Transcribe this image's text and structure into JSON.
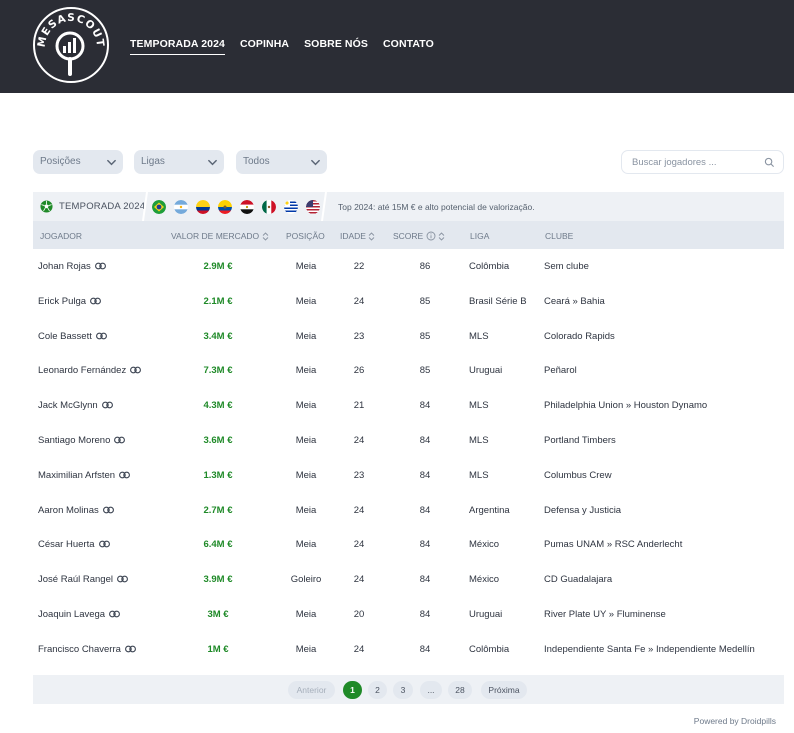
{
  "brand": {
    "logo_text": "MESASCOUT"
  },
  "nav": {
    "items": [
      {
        "label": "TEMPORADA 2024",
        "active": true
      },
      {
        "label": "COPINHA",
        "active": false
      },
      {
        "label": "SOBRE NÓS",
        "active": false
      },
      {
        "label": "CONTATO",
        "active": false
      }
    ]
  },
  "filters": {
    "positions": "Posições",
    "leagues": "Ligas",
    "all": "Todos",
    "search_placeholder": "Buscar jogadores ..."
  },
  "season": {
    "title": "TEMPORADA 2024",
    "flags": [
      "brazil",
      "argentina",
      "colombia",
      "ecuador",
      "egypt",
      "mexico",
      "uruguay",
      "usa"
    ],
    "description": "Top 2024: até 15M € e alto potencial de valorização."
  },
  "table": {
    "headers": {
      "player": "JOGADOR",
      "value": "VALOR DE MERCADO",
      "position": "POSIÇÃO",
      "age": "IDADE",
      "score": "SCORE",
      "league": "LIGA",
      "club": "CLUBE"
    },
    "rows": [
      {
        "name": "Johan Rojas",
        "value": "2.9M €",
        "position": "Meia",
        "age": "22",
        "score": "86",
        "league": "Colômbia",
        "club": "Sem clube"
      },
      {
        "name": "Erick Pulga",
        "value": "2.1M €",
        "position": "Meia",
        "age": "24",
        "score": "85",
        "league": "Brasil Série B",
        "club": "Ceará » Bahia"
      },
      {
        "name": "Cole Bassett",
        "value": "3.4M €",
        "position": "Meia",
        "age": "23",
        "score": "85",
        "league": "MLS",
        "club": "Colorado Rapids"
      },
      {
        "name": "Leonardo Fernández",
        "value": "7.3M €",
        "position": "Meia",
        "age": "26",
        "score": "85",
        "league": "Uruguai",
        "club": "Peñarol"
      },
      {
        "name": "Jack McGlynn",
        "value": "4.3M €",
        "position": "Meia",
        "age": "21",
        "score": "84",
        "league": "MLS",
        "club": "Philadelphia Union » Houston Dynamo"
      },
      {
        "name": "Santiago Moreno",
        "value": "3.6M €",
        "position": "Meia",
        "age": "24",
        "score": "84",
        "league": "MLS",
        "club": "Portland Timbers"
      },
      {
        "name": "Maximilian Arfsten",
        "value": "1.3M €",
        "position": "Meia",
        "age": "23",
        "score": "84",
        "league": "MLS",
        "club": "Columbus Crew"
      },
      {
        "name": "Aaron Molinas",
        "value": "2.7M €",
        "position": "Meia",
        "age": "24",
        "score": "84",
        "league": "Argentina",
        "club": "Defensa y Justicia"
      },
      {
        "name": "César Huerta",
        "value": "6.4M €",
        "position": "Meia",
        "age": "24",
        "score": "84",
        "league": "México",
        "club": "Pumas UNAM » RSC Anderlecht"
      },
      {
        "name": "José Raúl Rangel",
        "value": "3.9M €",
        "position": "Goleiro",
        "age": "24",
        "score": "84",
        "league": "México",
        "club": "CD Guadalajara"
      },
      {
        "name": "Joaquin Lavega",
        "value": "3M €",
        "position": "Meia",
        "age": "20",
        "score": "84",
        "league": "Uruguai",
        "club": "River Plate UY » Fluminense"
      },
      {
        "name": "Francisco Chaverra",
        "value": "1M €",
        "position": "Meia",
        "age": "24",
        "score": "84",
        "league": "Colômbia",
        "club": "Independiente Santa Fe » Independiente Medellín"
      }
    ]
  },
  "pagination": {
    "previous": "Anterior",
    "pages": [
      "1",
      "2",
      "3",
      "...",
      "28"
    ],
    "current": "1",
    "next": "Próxima"
  },
  "footer": {
    "powered": "Powered by Droidpills"
  },
  "colors": {
    "header_bg": "#2b2d35",
    "accent_green": "#1f8a28",
    "panel_bg": "#eef1f5",
    "thead_bg": "#e3e8ef"
  }
}
